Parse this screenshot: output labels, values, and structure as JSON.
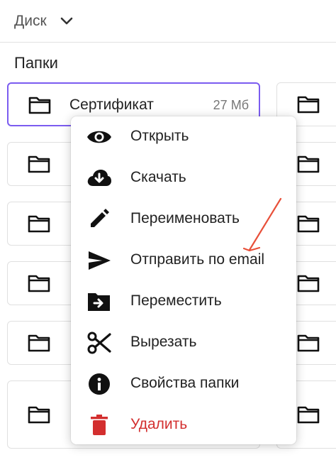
{
  "header": {
    "title": "Диск",
    "chevron_icon": "chevron-down-icon"
  },
  "section": {
    "title": "Папки"
  },
  "selected_folder": {
    "name": "Сертификат",
    "size": "27 Мб",
    "border_color": "#7b5cf0"
  },
  "menu": {
    "items": [
      {
        "label": "Открыть",
        "icon": "eye-icon"
      },
      {
        "label": "Скачать",
        "icon": "cloud-download-icon"
      },
      {
        "label": "Переименовать",
        "icon": "pencil-icon"
      },
      {
        "label": "Отправить по email",
        "icon": "send-icon"
      },
      {
        "label": "Переместить",
        "icon": "folder-move-icon"
      },
      {
        "label": "Вырезать",
        "icon": "scissors-icon"
      },
      {
        "label": "Свойства папки",
        "icon": "info-icon"
      },
      {
        "label": "Удалить",
        "icon": "trash-icon",
        "color": "#d32f2f"
      }
    ]
  },
  "colors": {
    "accent": "#7b5cf0",
    "danger": "#d32f2f",
    "annotation_arrow": "#e8503a"
  }
}
